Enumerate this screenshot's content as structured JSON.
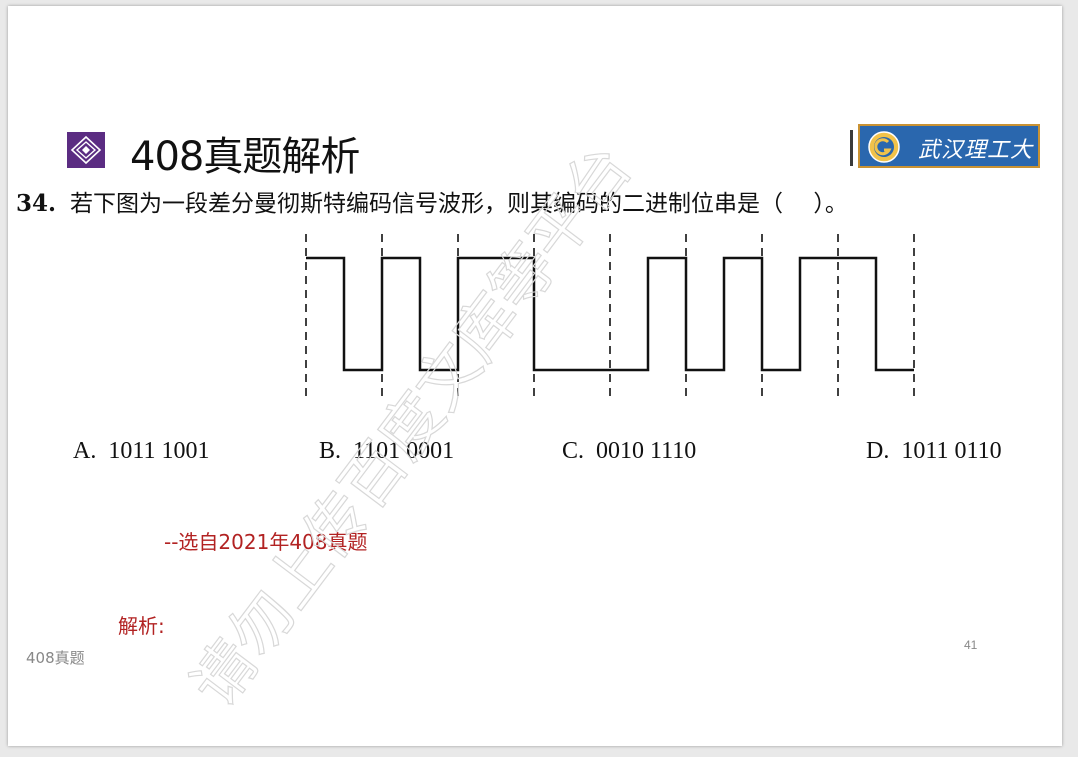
{
  "slide": {
    "title": "408真题解析",
    "logo_text": "武汉理工大学",
    "question_number": "34.",
    "question_text": "若下图为一段差分曼彻斯特编码信号波形，则其编码的二进制位串是（　 ）。",
    "options": [
      {
        "label": "A.",
        "value": "1011 1001"
      },
      {
        "label": "B.",
        "value": "1101 0001"
      },
      {
        "label": "C.",
        "value": "0010 1110"
      },
      {
        "label": "D.",
        "value": "1011 0110"
      }
    ],
    "source_note": "--选自2021年408真题",
    "analysis_label": "解析:",
    "footer": "408真题",
    "page_number": "41",
    "watermark": "请勿上传百度文库等平台"
  },
  "waveform": {
    "bits": 8,
    "levels": [
      1,
      0,
      1,
      0,
      1,
      1,
      0,
      0,
      0,
      1,
      0,
      1,
      0,
      1,
      1,
      0
    ]
  },
  "colors": {
    "accent_red": "#b22222",
    "logo_blue": "#2a67ae",
    "icon_purple": "#5b2c82"
  }
}
